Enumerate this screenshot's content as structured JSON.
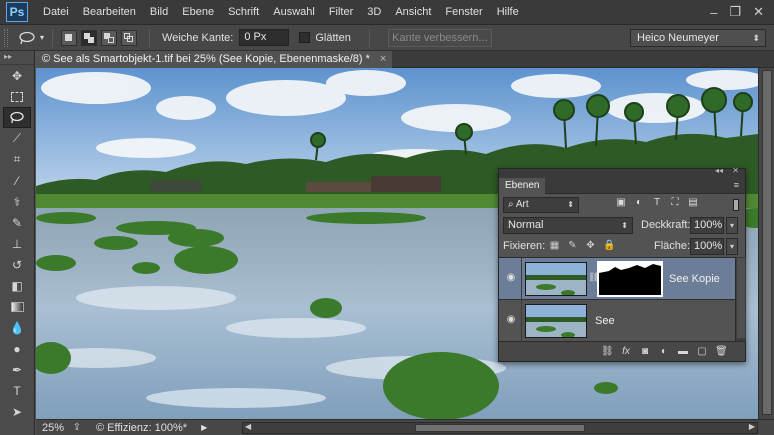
{
  "app": {
    "logo": "Ps"
  },
  "menu": [
    "Datei",
    "Bearbeiten",
    "Bild",
    "Ebene",
    "Schrift",
    "Auswahl",
    "Filter",
    "3D",
    "Ansicht",
    "Fenster",
    "Hilfe"
  ],
  "window_controls": [
    "minimize-icon",
    "restore-icon",
    "close-icon"
  ],
  "options": {
    "tool_icon": "lasso-icon",
    "feather_label": "Weiche Kante:",
    "feather_value": "0 Px",
    "antialias_label": "Glätten",
    "antialias_checked": false,
    "refine_label": "Kante verbessern...",
    "workspace": "Heico Neumeyer"
  },
  "document": {
    "tab_title": "© See als Smartobjekt-1.tif bei 25% (See Kopie, Ebenenmaske/8) *",
    "close_glyph": "×"
  },
  "status": {
    "zoom": "25%",
    "efficiency": "© Effizienz: 100%*"
  },
  "layers_panel": {
    "tab": "Ebenen",
    "filter_kind": "Art",
    "blend_mode": "Normal",
    "opacity_label": "Deckkraft:",
    "opacity_value": "100%",
    "lock_label": "Fixieren:",
    "fill_label": "Fläche:",
    "fill_value": "100%",
    "layers": [
      {
        "name": "See Kopie",
        "selected": true,
        "visible": true,
        "has_mask": true
      },
      {
        "name": "See",
        "selected": false,
        "visible": true,
        "has_mask": false
      }
    ],
    "bottom_icons": [
      "link-icon",
      "fx-icon",
      "mask-icon",
      "adjustment-icon",
      "group-icon",
      "new-layer-icon",
      "trash-icon"
    ]
  },
  "colors": {
    "accent_selected_layer": "#6c7d98",
    "logo_blue": "#5fa8e8",
    "chrome_dark": "#3a3a3a"
  }
}
